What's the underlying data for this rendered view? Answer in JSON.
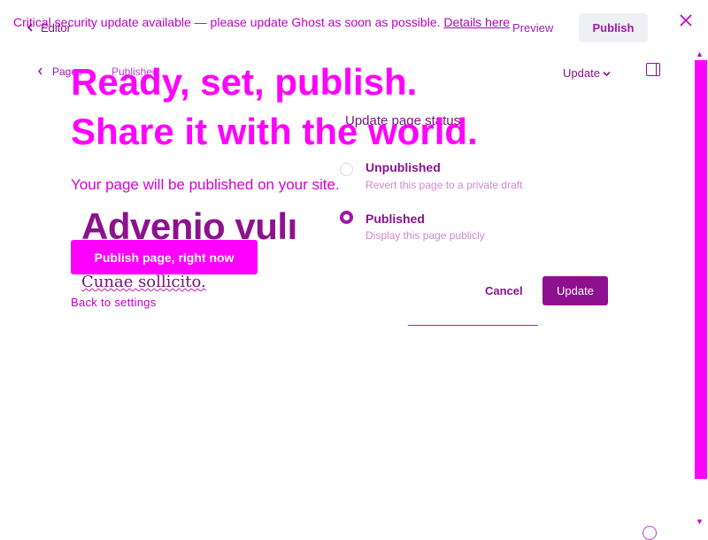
{
  "editor": {
    "back_label": "Editor",
    "preview_label": "Preview",
    "publish_label": "Publish",
    "breadcrumb": {
      "pages_label": "Pages",
      "status_label": "Published"
    },
    "update_menu_label": "Update",
    "page_title": "Advenio vulı",
    "page_body": "Cunae sollicito."
  },
  "status_popup": {
    "title": "Update page status",
    "options": [
      {
        "label": "Unpublished",
        "description": "Revert this page to a private draft",
        "selected": false
      },
      {
        "label": "Published",
        "description": "Display this page publicly",
        "selected": true
      }
    ],
    "cancel_label": "Cancel",
    "update_label": "Update"
  },
  "overlay": {
    "banner_text": "Critical security update available — please update Ghost as soon as possible.",
    "banner_link": "Details here",
    "heading_line1": "Ready, set, publish.",
    "heading_line2": "Share it with the world.",
    "subtext": "Your page will be published on your site.",
    "publish_button": "Publish page, right now",
    "back_link": "Back to settings"
  },
  "colors": {
    "overlay_accent": "#ff00ff",
    "editor_accent": "#8f108f"
  },
  "icons": [
    "chevron-left-icon",
    "chevron-down-icon",
    "sidebar-toggle-icon",
    "close-icon",
    "help-icon"
  ]
}
